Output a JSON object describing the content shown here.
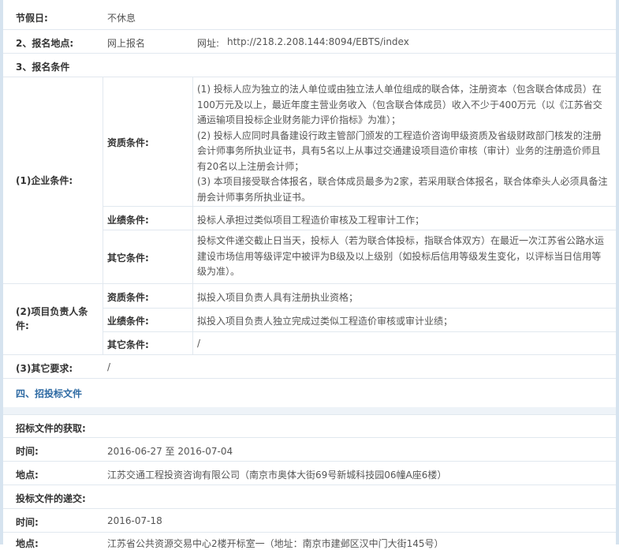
{
  "holiday": {
    "label": "节假日:",
    "value": "不休息"
  },
  "registration": {
    "label": "2、报名地点:",
    "method": "网上报名",
    "url_label": "网址:",
    "url": "http://218.2.208.144:8094/EBTS/index"
  },
  "conditions_title": "3、报名条件",
  "enterprise": {
    "label": "(1)企业条件:",
    "qualification_label": "资质条件:",
    "qualification_lines": [
      "(1) 投标人应为独立的法人单位或由独立法人单位组成的联合体，注册资本（包含联合体成员）在",
      "100万元及以上，最近年度主营业务收入（包含联合体成员）收入不少于400万元（以《江苏省交",
      "通运输项目投标企业财务能力评价指标》为准）；",
      "(2) 投标人应同时具备建设行政主管部门颁发的工程造价咨询甲级资质及省级财政部门核发的注册",
      "会计师事务所执业证书，具有5名以上从事过交通建设项目造价审核（审计）业务的注册造价师且",
      "有20名以上注册会计师；",
      "(3) 本项目接受联合体报名，联合体成员最多为2家，若采用联合体报名，联合体牵头人必须具备注",
      "册会计师事务所执业证书。"
    ],
    "performance_label": "业绩条件:",
    "performance_value": "投标人承担过类似项目工程造价审核及工程审计工作；",
    "other_label": "其它条件:",
    "other_lines": [
      "投标文件递交截止日当天，投标人（若为联合体投标，指联合体双方）在最近一次江苏省公路水运",
      "建设市场信用等级评定中被评为B级及以上级别（如投标后信用等级发生变化，以评标当日信用等",
      "级为准）。"
    ]
  },
  "manager": {
    "label_line1": "(2)项目负责人条",
    "label_line2": "件:",
    "qualification_label": "资质条件:",
    "qualification_value": "拟投入项目负责人具有注册执业资格；",
    "performance_label": "业绩条件:",
    "performance_value": "拟投入项目负责人独立完成过类似工程造价审核或审计业绩；",
    "other_label": "其它条件:",
    "other_value": "/"
  },
  "other_req": {
    "label": "(3)其它要求:",
    "value": "/"
  },
  "section4_title": "四、招投标文件",
  "doc_obtain": {
    "label": "招标文件的获取:",
    "time_label": "时间:",
    "time_value": "2016-06-27 至 2016-07-04",
    "place_label": "地点:",
    "place_value": "江苏交通工程投资咨询有限公司（南京市奥体大街69号新城科技园06幢A座6楼）"
  },
  "doc_submit": {
    "label": "投标文件的递交:",
    "time_label": "时间:",
    "time_value": "2016-07-18",
    "place_label": "地点:",
    "place_value": "江苏省公共资源交易中心2楼开标室一（地址：南京市建邺区汉中门大街145号）"
  }
}
